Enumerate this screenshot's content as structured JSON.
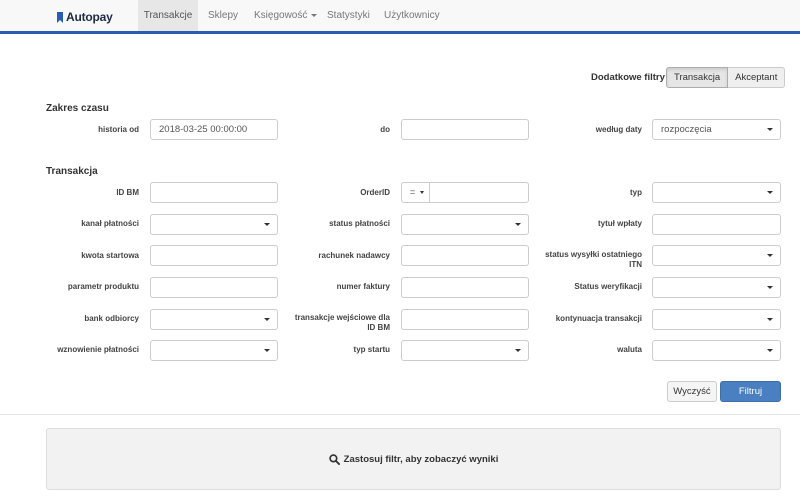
{
  "brand": {
    "name": "Autopay"
  },
  "nav": {
    "items": [
      {
        "label": "Transakcje",
        "active": true
      },
      {
        "label": "Sklepy",
        "active": false
      },
      {
        "label": "Księgowość",
        "active": false,
        "dropdown": true
      },
      {
        "label": "Statystyki",
        "active": false
      },
      {
        "label": "Użytkownicy",
        "active": false
      }
    ]
  },
  "filters_toggle": {
    "label": "Dodatkowe filtry",
    "options": [
      "Transakcja",
      "Akceptant"
    ],
    "selected": "Transakcja"
  },
  "time_range": {
    "title": "Zakres czasu",
    "history_from": {
      "label": "historia od",
      "value": "2018-03-25 00:00:00"
    },
    "to": {
      "label": "do",
      "value": ""
    },
    "by_date": {
      "label": "według daty",
      "value": "rozpoczęcia"
    }
  },
  "transaction": {
    "title": "Transakcja",
    "fields": {
      "id_bm": {
        "label": "ID BM",
        "value": ""
      },
      "order_id": {
        "label": "OrderID",
        "operator": "=",
        "value": ""
      },
      "type": {
        "label": "typ",
        "value": ""
      },
      "payment_channel": {
        "label": "kanał płatności",
        "value": ""
      },
      "payment_status": {
        "label": "status płatności",
        "value": ""
      },
      "payment_title": {
        "label": "tytuł wpłaty",
        "value": ""
      },
      "start_amount": {
        "label": "kwota startowa",
        "value": ""
      },
      "sender_account": {
        "label": "rachunek nadawcy",
        "value": ""
      },
      "last_itn_status": {
        "label": "status wysyłki ostatniego ITN",
        "value": ""
      },
      "product_param": {
        "label": "parametr produktu",
        "value": ""
      },
      "invoice_number": {
        "label": "numer faktury",
        "value": ""
      },
      "verification_status": {
        "label": "Status weryfikacji",
        "value": ""
      },
      "recipient_bank": {
        "label": "bank odbiorcy",
        "value": ""
      },
      "input_transactions": {
        "label": "transakcje wejściowe dla ID BM",
        "value": ""
      },
      "transaction_continuation": {
        "label": "kontynuacja transakcji",
        "value": ""
      },
      "payment_resume": {
        "label": "wznowienie płatności",
        "value": ""
      },
      "start_type": {
        "label": "typ startu",
        "value": ""
      },
      "currency": {
        "label": "waluta",
        "value": ""
      }
    }
  },
  "actions": {
    "clear_label": "Wyczyść",
    "filter_label": "Filtruj"
  },
  "results": {
    "message": "Zastosuj filtr, aby zobaczyć wyniki",
    "icon": "search-icon"
  },
  "colors": {
    "accent": "#2a5db0",
    "primary_button": "#4a7fc1"
  }
}
